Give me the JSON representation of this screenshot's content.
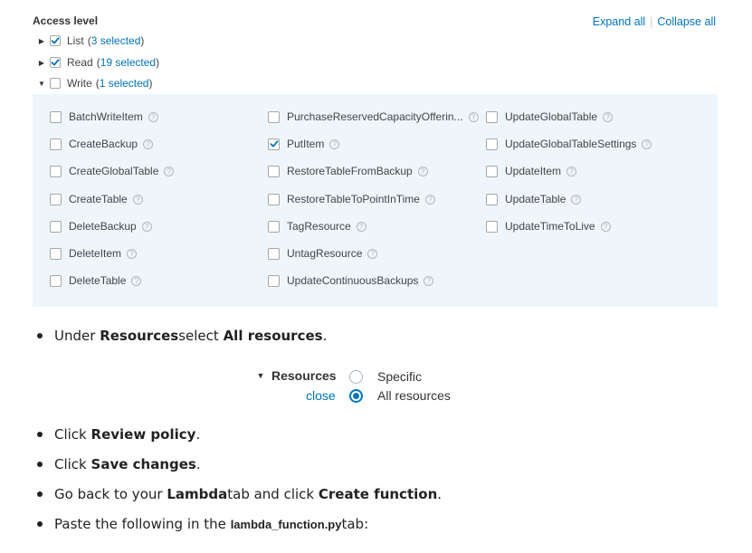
{
  "access": {
    "title": "Access level",
    "expand_all": "Expand all",
    "collapse_all": "Collapse all",
    "levels": [
      {
        "name": "List",
        "open": "(",
        "count": "3 selected",
        "close": ")",
        "checked": true,
        "expanded": false
      },
      {
        "name": "Read",
        "open": "(",
        "count": "19 selected",
        "close": ")",
        "checked": true,
        "expanded": false
      },
      {
        "name": "Write",
        "open": "(",
        "count": "1 selected",
        "close": ")",
        "checked": false,
        "expanded": true
      }
    ]
  },
  "write_actions": {
    "columns": [
      [
        {
          "name": "BatchWriteItem",
          "checked": false
        },
        {
          "name": "CreateBackup",
          "checked": false
        },
        {
          "name": "CreateGlobalTable",
          "checked": false
        },
        {
          "name": "CreateTable",
          "checked": false
        },
        {
          "name": "DeleteBackup",
          "checked": false
        },
        {
          "name": "DeleteItem",
          "checked": false
        },
        {
          "name": "DeleteTable",
          "checked": false
        }
      ],
      [
        {
          "name": "PurchaseReservedCapacityOfferin...",
          "checked": false
        },
        {
          "name": "PutItem",
          "checked": true
        },
        {
          "name": "RestoreTableFromBackup",
          "checked": false
        },
        {
          "name": "RestoreTableToPointInTime",
          "checked": false
        },
        {
          "name": "TagResource",
          "checked": false
        },
        {
          "name": "UntagResource",
          "checked": false
        },
        {
          "name": "UpdateContinuousBackups",
          "checked": false
        }
      ],
      [
        {
          "name": "UpdateGlobalTable",
          "checked": false
        },
        {
          "name": "UpdateGlobalTableSettings",
          "checked": false
        },
        {
          "name": "UpdateItem",
          "checked": false
        },
        {
          "name": "UpdateTable",
          "checked": false
        },
        {
          "name": "UpdateTimeToLive",
          "checked": false
        }
      ]
    ],
    "help_glyph": "?"
  },
  "instructions": {
    "step1": {
      "pre": "Under ",
      "b1": "Resources",
      "mid": " select ",
      "b2": "All resources",
      "post": "."
    },
    "step2": {
      "pre": "Click ",
      "b1": "Review policy",
      "post": "."
    },
    "step3": {
      "pre": "Click ",
      "b1": "Save changes",
      "post": "."
    },
    "step4": {
      "pre": "Go back to your ",
      "b1": "Lambda",
      "mid": " tab and click ",
      "b2": "Create function",
      "post": "."
    },
    "step5": {
      "pre": "Paste the following in the ",
      "code": "lambda_function.py",
      "post": " tab:"
    }
  },
  "resources": {
    "label": "Resources",
    "close": "close",
    "options": [
      {
        "label": "Specific",
        "selected": false
      },
      {
        "label": "All resources",
        "selected": true
      }
    ]
  }
}
